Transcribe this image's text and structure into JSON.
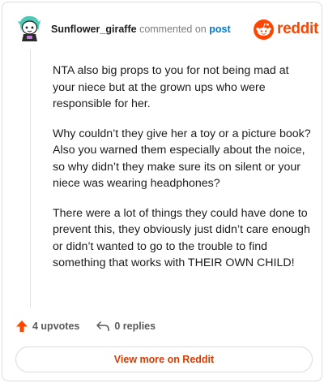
{
  "header": {
    "username": "Sunflower_giraffe",
    "action_text": "commented on",
    "post_link": "post",
    "brand": "reddit"
  },
  "comment": {
    "paragraphs": [
      "NTA also big props to you for not being mad at your niece but at the grown ups who were responsible for her.",
      "Why couldn’t they give her a toy or a picture book? Also you warned them especially about the noice, so why didn’t they make sure its on silent or your niece was wearing headphones?",
      "There were a lot of things they could have done to prevent this, they obviously just didn’t care enough or didn’t wanted to go to the trouble to find something that works with THEIR OWN CHILD!"
    ]
  },
  "actions": {
    "upvotes": "4 upvotes",
    "replies": "0 replies"
  },
  "footer": {
    "view_more": "View more on Reddit"
  },
  "colors": {
    "brand": "#ff4500",
    "link": "#0079d3",
    "view_more": "#d93a00"
  },
  "icons": [
    "user-avatar-icon",
    "reddit-snoo-icon",
    "upvote-arrow-icon",
    "reply-arrow-icon"
  ]
}
